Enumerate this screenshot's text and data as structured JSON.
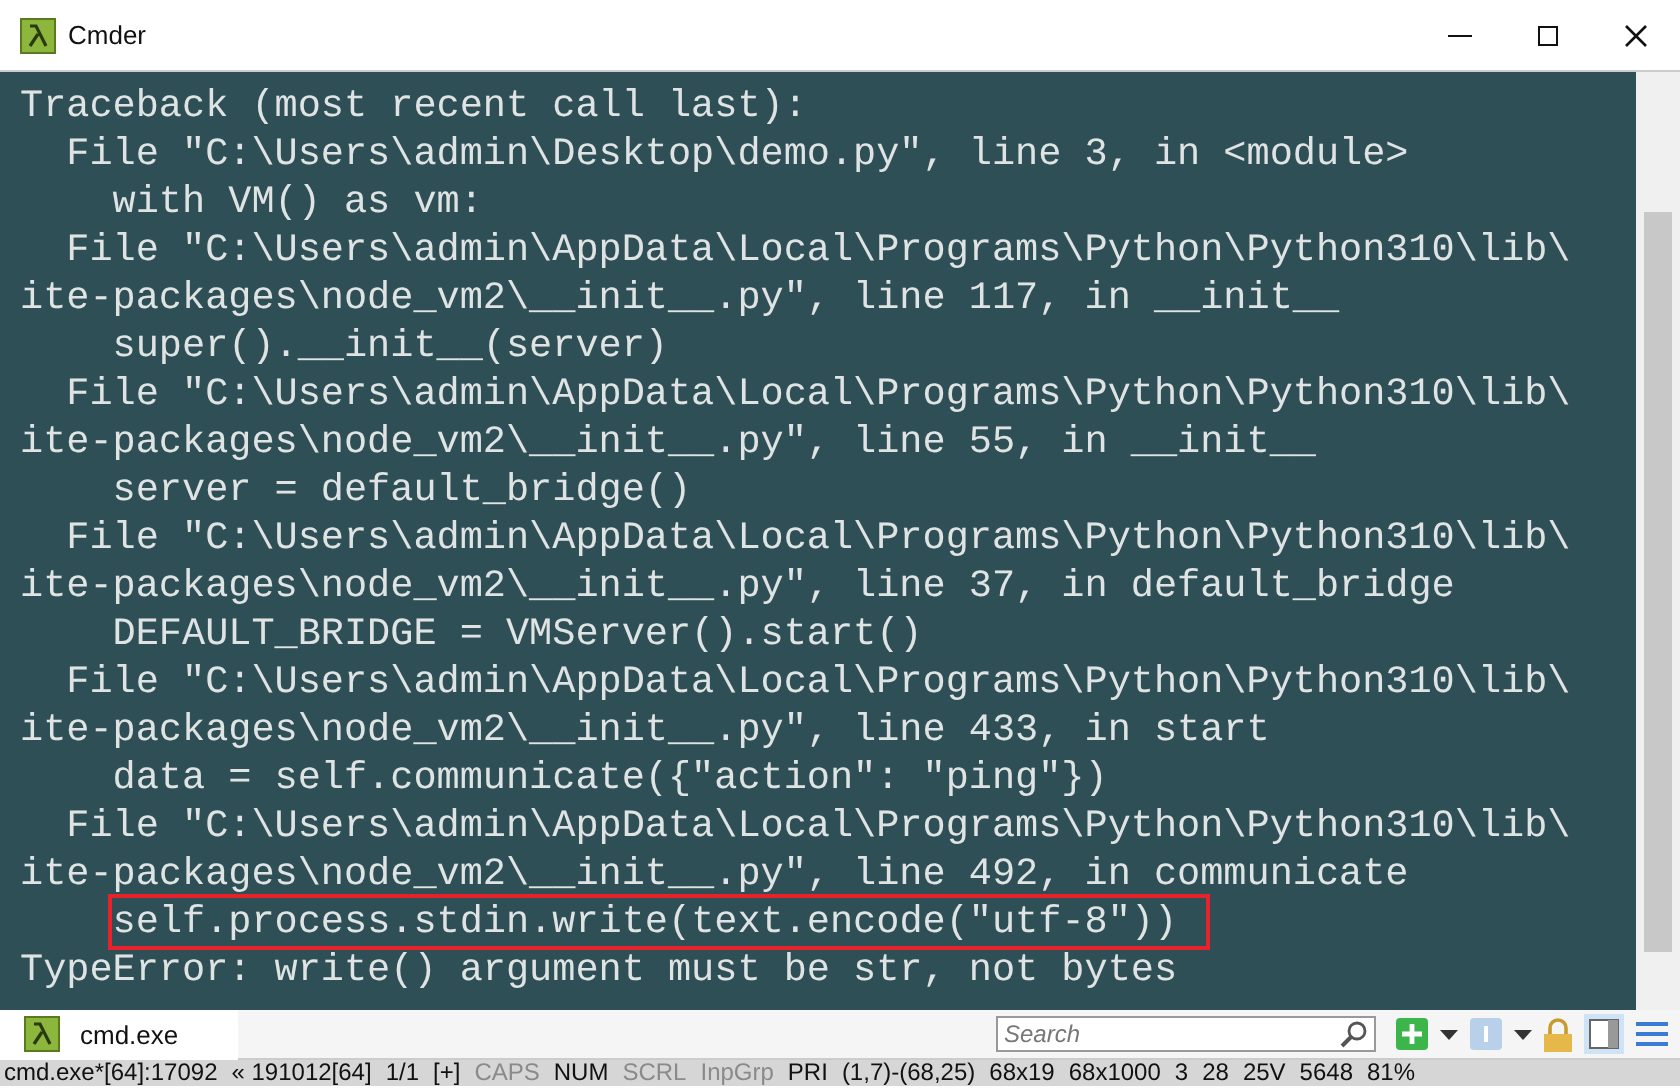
{
  "window": {
    "title": "Cmder"
  },
  "terminal": {
    "lines": [
      {
        "text": "Traceback (most recent call last):",
        "highlighted": false
      },
      {
        "text": "  File \"C:\\Users\\admin\\Desktop\\demo.py\", line 3, in <module>",
        "highlighted": false
      },
      {
        "text": "    with VM() as vm:",
        "highlighted": false
      },
      {
        "text": "  File \"C:\\Users\\admin\\AppData\\Local\\Programs\\Python\\Python310\\lib\\",
        "highlighted": false
      },
      {
        "text": "ite-packages\\node_vm2\\__init__.py\", line 117, in __init__",
        "highlighted": false
      },
      {
        "text": "    super().__init__(server)",
        "highlighted": false
      },
      {
        "text": "  File \"C:\\Users\\admin\\AppData\\Local\\Programs\\Python\\Python310\\lib\\",
        "highlighted": false
      },
      {
        "text": "ite-packages\\node_vm2\\__init__.py\", line 55, in __init__",
        "highlighted": false
      },
      {
        "text": "    server = default_bridge()",
        "highlighted": false
      },
      {
        "text": "  File \"C:\\Users\\admin\\AppData\\Local\\Programs\\Python\\Python310\\lib\\",
        "highlighted": false
      },
      {
        "text": "ite-packages\\node_vm2\\__init__.py\", line 37, in default_bridge",
        "highlighted": false
      },
      {
        "text": "    DEFAULT_BRIDGE = VMServer().start()",
        "highlighted": false
      },
      {
        "text": "  File \"C:\\Users\\admin\\AppData\\Local\\Programs\\Python\\Python310\\lib\\",
        "highlighted": false
      },
      {
        "text": "ite-packages\\node_vm2\\__init__.py\", line 433, in start",
        "highlighted": false
      },
      {
        "text": "    data = self.communicate({\"action\": \"ping\"})",
        "highlighted": false
      },
      {
        "text": "  File \"C:\\Users\\admin\\AppData\\Local\\Programs\\Python\\Python310\\lib\\",
        "highlighted": false
      },
      {
        "text": "ite-packages\\node_vm2\\__init__.py\", line 492, in communicate",
        "highlighted": false
      },
      {
        "text": "    self.process.stdin.write(text.encode(\"utf-8\"))",
        "highlighted": true
      },
      {
        "text": "TypeError: write() argument must be str, not bytes",
        "highlighted": false
      }
    ]
  },
  "tabs": [
    {
      "label": "cmd.exe",
      "selected": true
    }
  ],
  "search": {
    "placeholder": "Search"
  },
  "status_bar": {
    "items": [
      {
        "text": "cmd.exe*[64]:17092",
        "on": true
      },
      {
        "text": "« 191012[64]",
        "on": true
      },
      {
        "text": "1/1",
        "on": true
      },
      {
        "text": "[+]",
        "on": true
      },
      {
        "text": "CAPS",
        "on": false
      },
      {
        "text": "NUM",
        "on": true
      },
      {
        "text": "SCRL",
        "on": false
      },
      {
        "text": "InpGrp",
        "on": false
      },
      {
        "text": "PRI",
        "on": true
      },
      {
        "text": "(1,7)-(68,25)",
        "on": true
      },
      {
        "text": "68x19",
        "on": true
      },
      {
        "text": "68x1000",
        "on": true
      },
      {
        "text": "3",
        "on": true
      },
      {
        "text": "28",
        "on": true
      },
      {
        "text": "25V",
        "on": true
      },
      {
        "text": "5648",
        "on": true
      },
      {
        "text": "81%",
        "on": true
      }
    ]
  }
}
